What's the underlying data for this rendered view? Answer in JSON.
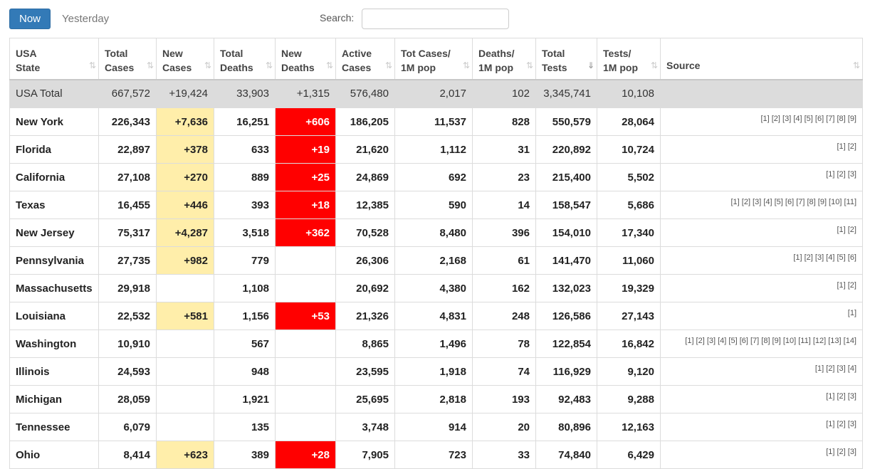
{
  "controls": {
    "now_label": "Now",
    "yesterday_label": "Yesterday",
    "search_label": "Search:",
    "search_value": ""
  },
  "headers": [
    [
      "USA",
      "State"
    ],
    [
      "Total",
      "Cases"
    ],
    [
      "New",
      "Cases"
    ],
    [
      "Total",
      "Deaths"
    ],
    [
      "New",
      "Deaths"
    ],
    [
      "Active",
      "Cases"
    ],
    [
      "Tot Cases/",
      "1M pop"
    ],
    [
      "Deaths/",
      "1M pop"
    ],
    [
      "Total",
      "Tests"
    ],
    [
      "Tests/",
      "1M pop"
    ],
    [
      "Source",
      ""
    ]
  ],
  "sort_icons": [
    "⇅",
    "⇅",
    "⇅",
    "⇅",
    "⇅",
    "⇅",
    "⇅",
    "⇅",
    "⇓",
    "⇅",
    "⇅"
  ],
  "total": {
    "state": "USA Total",
    "total_cases": "667,572",
    "new_cases": "+19,424",
    "total_deaths": "33,903",
    "new_deaths": "+1,315",
    "active_cases": "576,480",
    "cases_per_m": "2,017",
    "deaths_per_m": "102",
    "total_tests": "3,345,741",
    "tests_per_m": "10,108",
    "source": ""
  },
  "rows": [
    {
      "state": "New York",
      "total_cases": "226,343",
      "new_cases": "+7,636",
      "total_deaths": "16,251",
      "new_deaths": "+606",
      "active_cases": "186,205",
      "cases_per_m": "11,537",
      "deaths_per_m": "828",
      "total_tests": "550,579",
      "tests_per_m": "28,064",
      "source": "[1] [2] [3] [4] [5] [6] [7] [8] [9]"
    },
    {
      "state": "Florida",
      "total_cases": "22,897",
      "new_cases": "+378",
      "total_deaths": "633",
      "new_deaths": "+19",
      "active_cases": "21,620",
      "cases_per_m": "1,112",
      "deaths_per_m": "31",
      "total_tests": "220,892",
      "tests_per_m": "10,724",
      "source": "[1] [2]"
    },
    {
      "state": "California",
      "total_cases": "27,108",
      "new_cases": "+270",
      "total_deaths": "889",
      "new_deaths": "+25",
      "active_cases": "24,869",
      "cases_per_m": "692",
      "deaths_per_m": "23",
      "total_tests": "215,400",
      "tests_per_m": "5,502",
      "source": "[1] [2] [3]"
    },
    {
      "state": "Texas",
      "total_cases": "16,455",
      "new_cases": "+446",
      "total_deaths": "393",
      "new_deaths": "+18",
      "active_cases": "12,385",
      "cases_per_m": "590",
      "deaths_per_m": "14",
      "total_tests": "158,547",
      "tests_per_m": "5,686",
      "source": "[1] [2] [3] [4] [5] [6] [7] [8] [9] [10] [11]"
    },
    {
      "state": "New Jersey",
      "total_cases": "75,317",
      "new_cases": "+4,287",
      "total_deaths": "3,518",
      "new_deaths": "+362",
      "active_cases": "70,528",
      "cases_per_m": "8,480",
      "deaths_per_m": "396",
      "total_tests": "154,010",
      "tests_per_m": "17,340",
      "source": "[1] [2]"
    },
    {
      "state": "Pennsylvania",
      "total_cases": "27,735",
      "new_cases": "+982",
      "total_deaths": "779",
      "new_deaths": "",
      "active_cases": "26,306",
      "cases_per_m": "2,168",
      "deaths_per_m": "61",
      "total_tests": "141,470",
      "tests_per_m": "11,060",
      "source": "[1] [2] [3] [4] [5] [6]"
    },
    {
      "state": "Massachusetts",
      "total_cases": "29,918",
      "new_cases": "",
      "total_deaths": "1,108",
      "new_deaths": "",
      "active_cases": "20,692",
      "cases_per_m": "4,380",
      "deaths_per_m": "162",
      "total_tests": "132,023",
      "tests_per_m": "19,329",
      "source": "[1] [2]"
    },
    {
      "state": "Louisiana",
      "total_cases": "22,532",
      "new_cases": "+581",
      "total_deaths": "1,156",
      "new_deaths": "+53",
      "active_cases": "21,326",
      "cases_per_m": "4,831",
      "deaths_per_m": "248",
      "total_tests": "126,586",
      "tests_per_m": "27,143",
      "source": "[1]"
    },
    {
      "state": "Washington",
      "total_cases": "10,910",
      "new_cases": "",
      "total_deaths": "567",
      "new_deaths": "",
      "active_cases": "8,865",
      "cases_per_m": "1,496",
      "deaths_per_m": "78",
      "total_tests": "122,854",
      "tests_per_m": "16,842",
      "source": "[1] [2] [3] [4] [5] [6] [7] [8] [9] [10] [11] [12] [13] [14]"
    },
    {
      "state": "Illinois",
      "total_cases": "24,593",
      "new_cases": "",
      "total_deaths": "948",
      "new_deaths": "",
      "active_cases": "23,595",
      "cases_per_m": "1,918",
      "deaths_per_m": "74",
      "total_tests": "116,929",
      "tests_per_m": "9,120",
      "source": "[1] [2] [3] [4]"
    },
    {
      "state": "Michigan",
      "total_cases": "28,059",
      "new_cases": "",
      "total_deaths": "1,921",
      "new_deaths": "",
      "active_cases": "25,695",
      "cases_per_m": "2,818",
      "deaths_per_m": "193",
      "total_tests": "92,483",
      "tests_per_m": "9,288",
      "source": "[1] [2] [3]"
    },
    {
      "state": "Tennessee",
      "total_cases": "6,079",
      "new_cases": "",
      "total_deaths": "135",
      "new_deaths": "",
      "active_cases": "3,748",
      "cases_per_m": "914",
      "deaths_per_m": "20",
      "total_tests": "80,896",
      "tests_per_m": "12,163",
      "source": "[1] [2] [3]"
    },
    {
      "state": "Ohio",
      "total_cases": "8,414",
      "new_cases": "+623",
      "total_deaths": "389",
      "new_deaths": "+28",
      "active_cases": "7,905",
      "cases_per_m": "723",
      "deaths_per_m": "33",
      "total_tests": "74,840",
      "tests_per_m": "6,429",
      "source": "[1] [2] [3]"
    }
  ],
  "colors": {
    "now_button": "#337ab7",
    "new_cases_highlight": "#ffeeaa",
    "new_deaths_highlight": "#ff0000",
    "total_row_bg": "#dcdcdc"
  }
}
